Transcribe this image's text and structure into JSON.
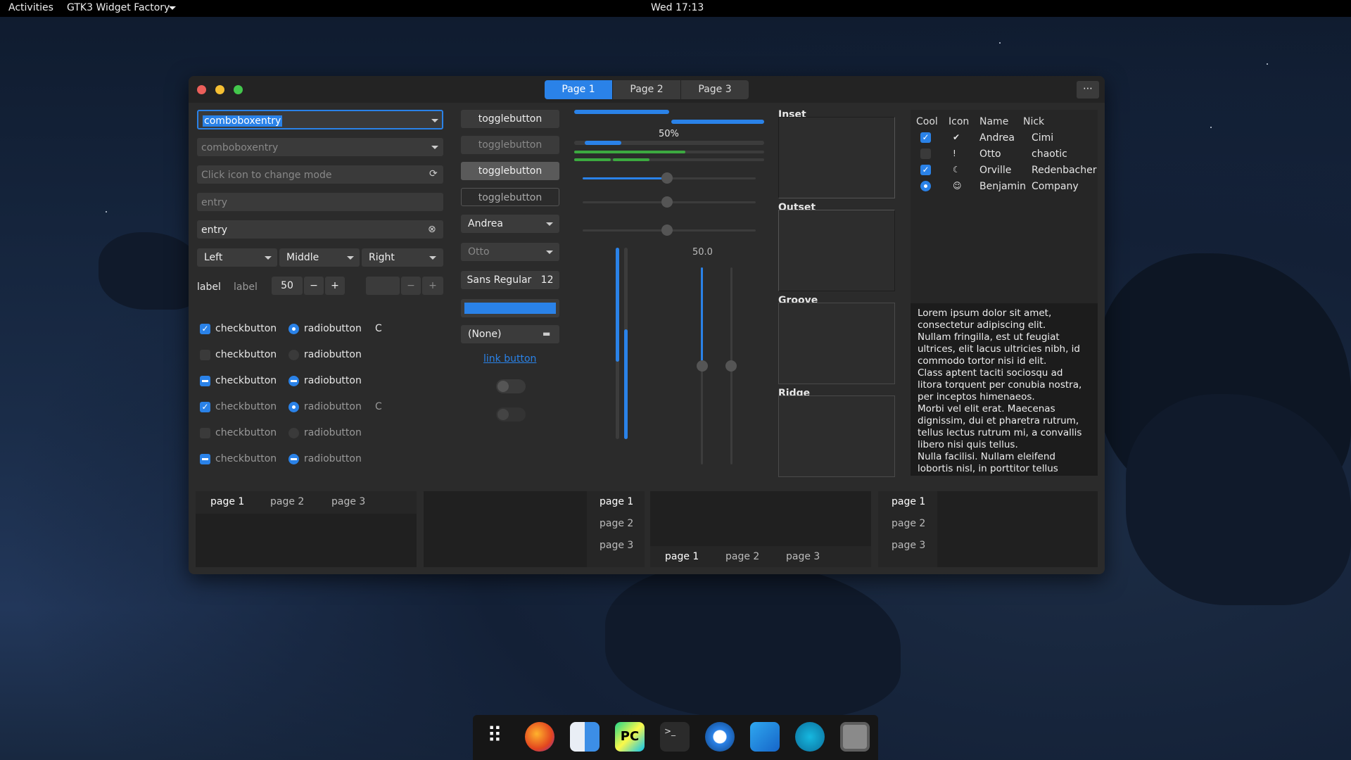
{
  "topbar": {
    "activities": "Activities",
    "app_menu": "GTK3 Widget Factory",
    "clock": "Wed 17:13"
  },
  "window": {
    "tabs": [
      "Page 1",
      "Page 2",
      "Page 3"
    ],
    "menu_glyph": "⋯"
  },
  "col1": {
    "combo1": "comboboxentry",
    "combo2": "comboboxentry",
    "entry_placeholder": "Click icon to change mode",
    "entry_dim": "entry",
    "entry_val": "entry",
    "combos": [
      "Left",
      "Middle",
      "Right"
    ],
    "label1": "label",
    "label2": "label",
    "spin_value": "50",
    "minus": "−",
    "plus": "+",
    "checks": [
      {
        "label": "checkbutton",
        "state": "checked",
        "rlabel": "radiobutton",
        "rstate": "on",
        "spinner": "C"
      },
      {
        "label": "checkbutton",
        "state": "off",
        "rlabel": "radiobutton",
        "rstate": "off"
      },
      {
        "label": "checkbutton",
        "state": "mixed",
        "rlabel": "radiobutton",
        "rstate": "mixed"
      },
      {
        "label": "checkbutton",
        "state": "checked",
        "rlabel": "radiobutton",
        "rstate": "on",
        "spinner": "C"
      },
      {
        "label": "checkbutton",
        "state": "off",
        "rlabel": "radiobutton",
        "rstate": "off"
      },
      {
        "label": "checkbutton",
        "state": "mixed",
        "rlabel": "radiobutton",
        "rstate": "mixed"
      }
    ]
  },
  "col2": {
    "toggles": [
      "togglebutton",
      "togglebutton",
      "togglebutton",
      "togglebutton"
    ],
    "combo_andrea": "Andrea",
    "combo_otto": "Otto",
    "font_name": "Sans Regular",
    "font_size": "12",
    "file_none": "(None)",
    "link": "link button"
  },
  "col3": {
    "progress_label": "50%",
    "progress_value": 0.5,
    "scale_value": "50.0",
    "scale_level": 0.5
  },
  "frames": [
    "Inset",
    "Outset",
    "Groove",
    "Ridge"
  ],
  "tree": {
    "headers": [
      "Cool",
      "Icon",
      "Name",
      "Nick"
    ],
    "rows": [
      {
        "cool": "checked",
        "icon": "check-circle-icon",
        "glyph": "✔",
        "name": "Andrea",
        "nick": "Cimi"
      },
      {
        "cool": "off",
        "icon": "info-icon",
        "glyph": "!",
        "name": "Otto",
        "nick": "chaotic"
      },
      {
        "cool": "checked",
        "icon": "moon-icon",
        "glyph": "☾",
        "name": "Orville",
        "nick": "Redenbacher"
      },
      {
        "cool": "radio",
        "icon": "face-icon",
        "glyph": "☺",
        "name": "Benjamin",
        "nick": "Company"
      }
    ]
  },
  "textview": [
    "Lorem ipsum dolor sit amet,",
    "consectetur adipiscing elit.",
    "Nullam fringilla, est ut feugiat",
    "ultrices, elit lacus ultricies nibh, id",
    "commodo tortor nisi id elit.",
    "Class aptent taciti sociosqu ad",
    "litora torquent per conubia nostra,",
    "per inceptos himenaeos.",
    "Morbi vel elit erat. Maecenas",
    "dignissim, dui et pharetra rutrum,",
    "tellus lectus rutrum mi, a convallis",
    "libero nisi quis tellus.",
    "Nulla facilisi. Nullam eleifend",
    "lobortis nisl, in porttitor tellus"
  ],
  "notebooks": {
    "tabs": [
      "page 1",
      "page 2",
      "page 3"
    ]
  },
  "colors": {
    "accent": "#2a82e8",
    "window": "#2b2b2b",
    "header": "#232323"
  }
}
